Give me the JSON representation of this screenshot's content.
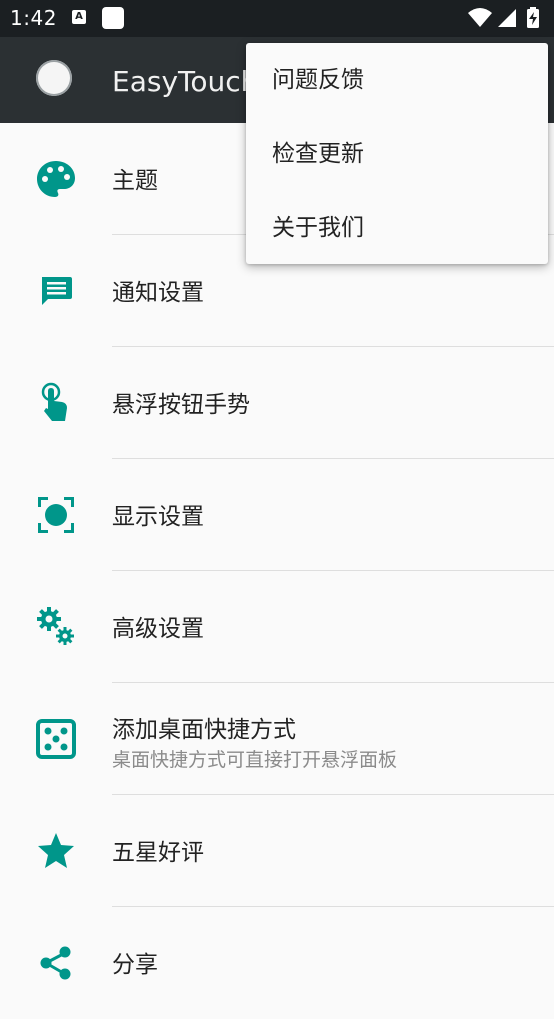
{
  "status_bar": {
    "time": "1:42",
    "notification_a": "A",
    "icons": [
      "notification-a-icon",
      "notification-square-icon",
      "wifi-icon",
      "signal-icon",
      "battery-charging-icon"
    ]
  },
  "app_bar": {
    "title": "EasyTouch",
    "logo_icon": "circle-logo-icon",
    "background": "#2b3033"
  },
  "menu": {
    "items": [
      {
        "label": "问题反馈"
      },
      {
        "label": "检查更新"
      },
      {
        "label": "关于我们"
      }
    ]
  },
  "list": {
    "accent_color": "#00968a",
    "items": [
      {
        "icon": "palette-icon",
        "label": "主题"
      },
      {
        "icon": "message-icon",
        "label": "通知设置"
      },
      {
        "icon": "touch-gesture-icon",
        "label": "悬浮按钮手势"
      },
      {
        "icon": "display-focus-icon",
        "label": "显示设置"
      },
      {
        "icon": "gears-icon",
        "label": "高级设置"
      },
      {
        "icon": "dice-icon",
        "label": "添加桌面快捷方式",
        "sublabel": "桌面快捷方式可直接打开悬浮面板"
      },
      {
        "icon": "star-icon",
        "label": "五星好评"
      },
      {
        "icon": "share-icon",
        "label": "分享"
      }
    ]
  }
}
